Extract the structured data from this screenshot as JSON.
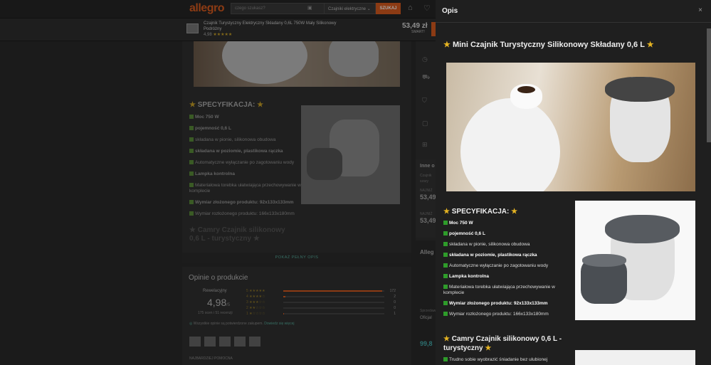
{
  "header": {
    "logo": "allegro",
    "search_placeholder": "czego szukasz?",
    "category": "Czajniki elektryczne",
    "search_button": "SZUKAJ"
  },
  "product_bar": {
    "title": "Czajnik Turystyczny Elektryczny Składany 0,6L 750W Mały Silikonowy Podróżny",
    "rating": "4,98",
    "stars": "★★★★★",
    "price": "53,49 zł",
    "smart": "SMART!"
  },
  "content": {
    "spec_heading": "SPECYFIKACJA:",
    "specs": [
      {
        "text": "Moc 750 W",
        "bold": true
      },
      {
        "text": "pojemność 0,6 L",
        "bold": true
      },
      {
        "text": "składana w pionie, silikonowa obudowa",
        "bold": false
      },
      {
        "text": "składana w poziomie, plastikowa rączka",
        "bold": true
      },
      {
        "text": "Automatyczne wyłączanie po zagotowaniu wody",
        "bold": false
      },
      {
        "text": "Lampka kontrolna",
        "bold": true
      },
      {
        "text": "Materiałowa torebka ułatwiająca przechowywanie w komplecie",
        "bold": false
      },
      {
        "text": "Wymiar złożonego produktu: 92x133x133mm",
        "bold": true
      },
      {
        "text": "Wymiar rozłożonego produktu: 166x133x180mm",
        "bold": false
      }
    ],
    "camry_heading": "Camry Czajnik silikonowy 0,6 L - turystyczny",
    "show_full": "POKAŻ PEŁNY OPIS"
  },
  "reviews": {
    "heading": "Opinie o produkcie",
    "recommended": "Rewelacyjny",
    "rating": "4,98",
    "rating_max": "/5",
    "count": "175 ocen i 51 recenzji",
    "rows": [
      {
        "stars": "5 ★★★★★",
        "count": "172",
        "fill": 0.98
      },
      {
        "stars": "4 ★★★★☆",
        "count": "2",
        "fill": 0.02
      },
      {
        "stars": "3 ★★★☆☆",
        "count": "0",
        "fill": 0
      },
      {
        "stars": "2 ★★☆☆☆",
        "count": "0",
        "fill": 0
      },
      {
        "stars": "1 ★☆☆☆☆",
        "count": "1",
        "fill": 0.01
      }
    ],
    "verified": "Wszystkie opinie są potwierdzone zakupem.",
    "verified_link": "Dowiedz się więcej",
    "most_helpful": "NAJBARDZIEJ POMOCNA"
  },
  "side": {
    "inne": "Inne o",
    "czajnik": "Czajnik",
    "szary": "szary",
    "najnizsza1": "NAJNIŻ",
    "price1": "53,49",
    "najnizsza2": "NAJNIŻ",
    "price2": "53,49",
    "allegro": "Alleg",
    "sprzedawca": "Sprzedaw",
    "oficjalny": "Oficjal",
    "price3": "99,8"
  },
  "panel": {
    "title": "Opis",
    "close": "×",
    "mini_heading": "Mini Czajnik Turystyczny Silikonowy Składany 0,6 L",
    "spec_heading": "SPECYFIKACJA:",
    "specs": [
      {
        "text": "Moc 750 W",
        "bold": true
      },
      {
        "text": "pojemność 0,6 L",
        "bold": true
      },
      {
        "text": "składana w pionie, silikonowa obudowa",
        "bold": false
      },
      {
        "text": "składana w poziomie, plastikowa rączka",
        "bold": true
      },
      {
        "text": "Automatyczne wyłączanie po zagotowaniu wody",
        "bold": false
      },
      {
        "text": "Lampka kontrolna",
        "bold": true
      },
      {
        "text": "Materiałowa torebka ułatwiająca przechowywanie w komplecie",
        "bold": false
      },
      {
        "text": "Wymiar złożonego produktu: 92x133x133mm",
        "bold": true
      },
      {
        "text": "Wymiar rozłożonego produktu: 166x133x180mm",
        "bold": false
      }
    ],
    "camry_heading": "Camry Czajnik silikonowy 0,6 L - turystyczny",
    "trudno": "Trudno sobie wyobrazić śniadanie bez ulubionej"
  }
}
